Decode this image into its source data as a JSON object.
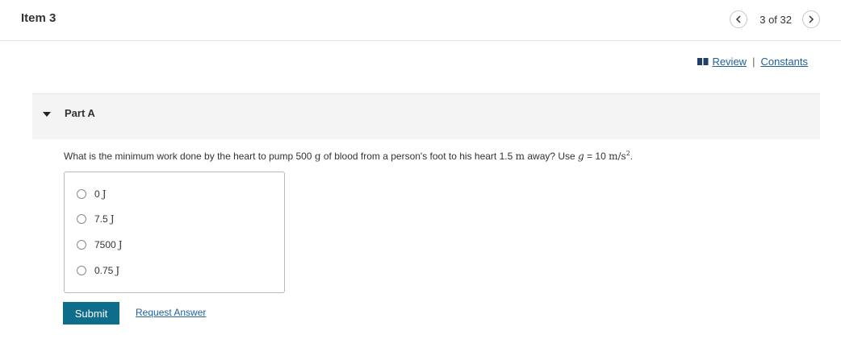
{
  "header": {
    "title": "Item 3",
    "pager_text": "3 of 32"
  },
  "resources": {
    "review_label": "Review",
    "separator": "|",
    "constants_label": "Constants"
  },
  "part": {
    "label": "Part A",
    "question": {
      "prefix": "What is the minimum work done by the heart to pump 500 ",
      "mass_unit": "g",
      "middle": " of blood from a person's foot to his heart 1.5 ",
      "dist_unit": "m",
      "after_dist": " away? Use ",
      "g_symbol": "g",
      "equals": " = 10 ",
      "accel_unit": "m/s",
      "exponent": "2",
      "end": "."
    },
    "choices": [
      {
        "value": "0",
        "unit": "J"
      },
      {
        "value": "7.5",
        "unit": "J"
      },
      {
        "value": "7500",
        "unit": "J"
      },
      {
        "value": "0.75",
        "unit": "J"
      }
    ]
  },
  "actions": {
    "submit_label": "Submit",
    "request_label": "Request Answer"
  },
  "colors": {
    "link": "#1d5f9f",
    "submit_bg": "#0e6d8a",
    "part_header_bg": "#f4f4f4"
  },
  "icons": {
    "prev": "chevron-left-icon",
    "next": "chevron-right-icon",
    "review": "book-icon",
    "collapse": "caret-down-icon"
  }
}
